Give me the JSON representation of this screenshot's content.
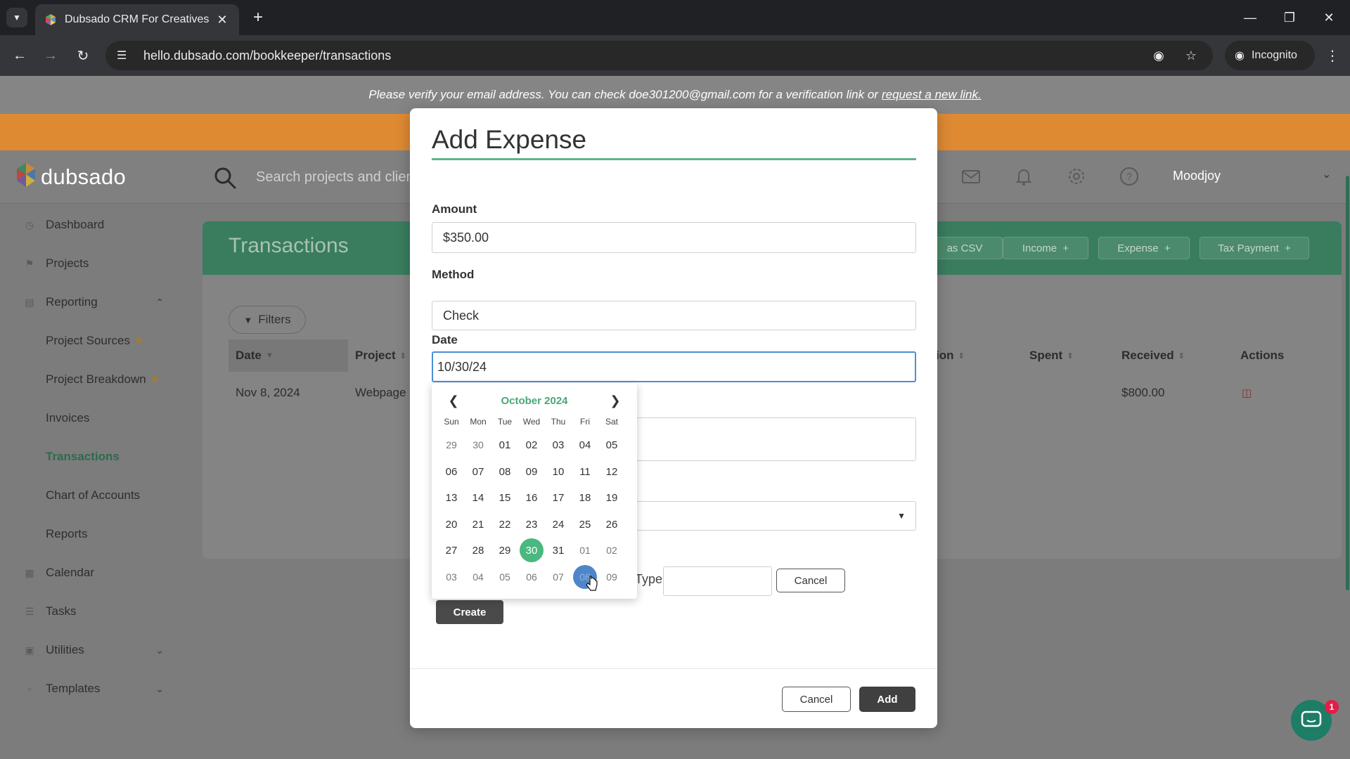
{
  "browser": {
    "tab_title": "Dubsado CRM For Creatives",
    "url": "hello.dubsado.com/bookkeeper/transactions",
    "incognito_label": "Incognito"
  },
  "banner": {
    "message": "Please verify your email address. You can check doe301200@gmail.com for a verification link or",
    "link": "request a new link."
  },
  "header": {
    "logo_text": "dubsado",
    "search_placeholder": "Search projects and clients",
    "user_name": "Moodjoy"
  },
  "sidebar": {
    "items": [
      {
        "label": "Dashboard"
      },
      {
        "label": "Projects"
      },
      {
        "label": "Reporting"
      },
      {
        "label": "Project Sources"
      },
      {
        "label": "Project Breakdown"
      },
      {
        "label": "Invoices"
      },
      {
        "label": "Transactions"
      },
      {
        "label": "Chart of Accounts"
      },
      {
        "label": "Reports"
      },
      {
        "label": "Calendar"
      },
      {
        "label": "Tasks"
      },
      {
        "label": "Utilities"
      },
      {
        "label": "Templates"
      }
    ]
  },
  "transactions": {
    "title": "Transactions",
    "buttons": {
      "export": "as CSV",
      "income": "Income",
      "expense": "Expense",
      "tax": "Tax Payment"
    },
    "filters_label": "Filters",
    "columns": {
      "date": "Date",
      "project": "Project",
      "description": "ion",
      "spent": "Spent",
      "received": "Received",
      "actions": "Actions"
    },
    "row": {
      "date": "Nov 8, 2024",
      "project": "Webpage",
      "received": "$800.00"
    }
  },
  "modal": {
    "title": "Add Expense",
    "amount_label": "Amount",
    "amount_value": "$350.00",
    "method_label": "Method",
    "method_value": "Check",
    "date_label": "Date",
    "date_value": "10/30/24",
    "type_label": "Type",
    "inline_cancel": "Cancel",
    "create_label": "Create",
    "cancel_label": "Cancel",
    "add_label": "Add"
  },
  "datepicker": {
    "month_label": "October 2024",
    "weekdays": [
      "Sun",
      "Mon",
      "Tue",
      "Wed",
      "Thu",
      "Fri",
      "Sat"
    ],
    "weeks": [
      [
        "29",
        "30",
        "01",
        "02",
        "03",
        "04",
        "05"
      ],
      [
        "06",
        "07",
        "08",
        "09",
        "10",
        "11",
        "12"
      ],
      [
        "13",
        "14",
        "15",
        "16",
        "17",
        "18",
        "19"
      ],
      [
        "20",
        "21",
        "22",
        "23",
        "24",
        "25",
        "26"
      ],
      [
        "27",
        "28",
        "29",
        "30",
        "31",
        "01",
        "02"
      ],
      [
        "03",
        "04",
        "05",
        "06",
        "07",
        "08",
        "09"
      ]
    ],
    "selected": "30"
  },
  "chat": {
    "badge": "1"
  },
  "colors": {
    "brand_green": "#3a7d5e",
    "accent_green": "#4ab87f",
    "orange": "#de8a33",
    "focus_blue": "#4b8fd6"
  }
}
